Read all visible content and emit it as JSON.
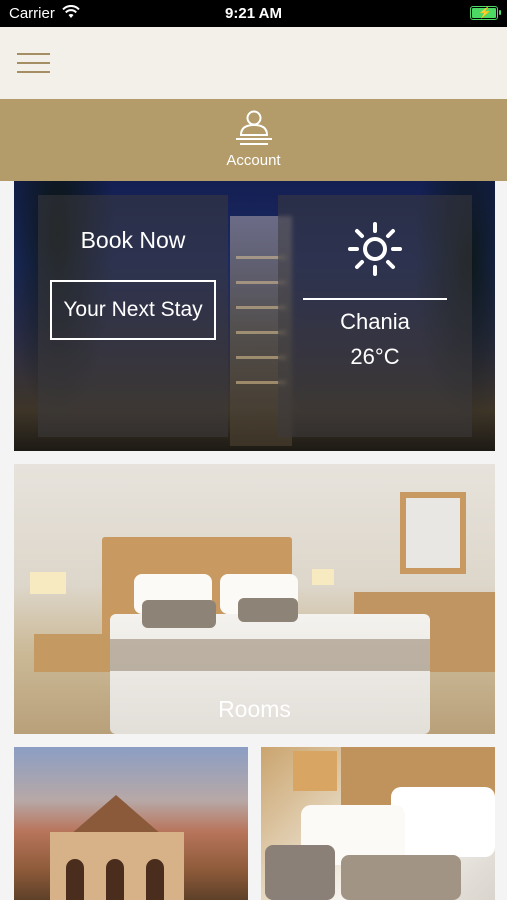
{
  "status_bar": {
    "carrier": "Carrier",
    "time": "9:21 AM",
    "wifi_icon": "wifi-icon",
    "battery_icon": "battery-charging-icon"
  },
  "nav": {
    "menu_icon": "hamburger-menu-icon"
  },
  "account": {
    "label": "Account",
    "icon": "user-icon"
  },
  "hero": {
    "book_title": "Book Now",
    "book_button": "Your Next Stay",
    "weather_icon": "sun-icon",
    "city": "Chania",
    "temperature": "26°C"
  },
  "rooms": {
    "label": "Rooms"
  },
  "colors": {
    "gold": "#b39b6a",
    "header_bg": "#f3f0ea",
    "menu_icon": "#a58e63"
  }
}
